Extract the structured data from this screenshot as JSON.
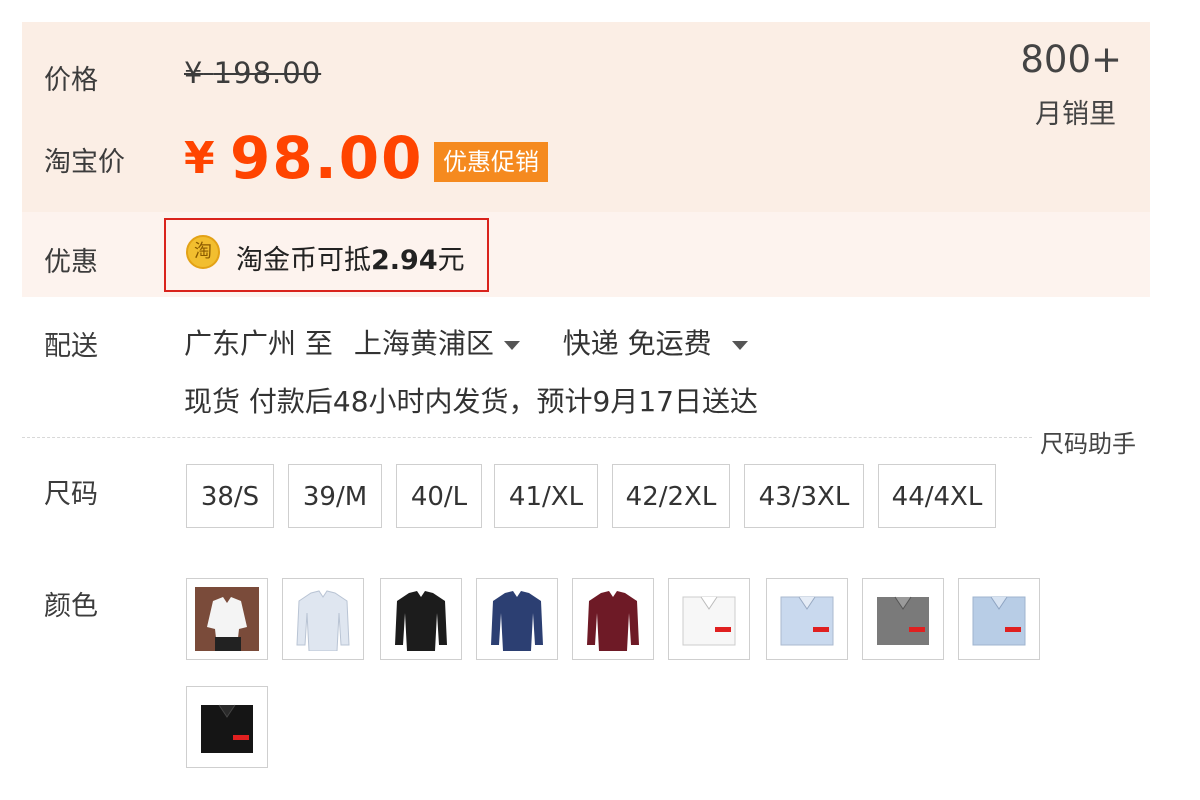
{
  "price": {
    "label": "价格",
    "original_currency": "¥",
    "original_value": "198.00",
    "taobao_label": "淘宝价",
    "currency": "¥",
    "value": "98.00",
    "promo_tag": "优惠促销",
    "sales_count": "800+",
    "sales_label": "月销里"
  },
  "discount": {
    "label": "优惠",
    "icon_text": "淘",
    "text": "淘金币可抵",
    "amount": "2.94",
    "unit": "元"
  },
  "shipping": {
    "label": "配送",
    "from": "广东广州 至",
    "to": "上海黄浦区",
    "method": "快递 免运费",
    "detail": "现货 付款后48小时内发货，预计9月17日送达"
  },
  "size": {
    "label": "尺码",
    "helper": "尺码助手",
    "options": [
      "38/S",
      "39/M",
      "40/L",
      "41/XL",
      "42/2XL",
      "43/3XL",
      "44/4XL"
    ]
  },
  "color": {
    "label": "颜色",
    "swatches": [
      {
        "name": "white-model",
        "color": "#f4f4f4"
      },
      {
        "name": "light-blue",
        "color": "#dfe6f0"
      },
      {
        "name": "black",
        "color": "#1c1c1c"
      },
      {
        "name": "navy",
        "color": "#2c3f72"
      },
      {
        "name": "burgundy",
        "color": "#6e1a26"
      },
      {
        "name": "white-folded",
        "color": "#f7f7f7"
      },
      {
        "name": "light-blue-folded",
        "color": "#c9d9ee"
      },
      {
        "name": "gray-folded",
        "color": "#7a7a7a"
      },
      {
        "name": "sky-blue-folded",
        "color": "#b8cde6"
      },
      {
        "name": "black-folded",
        "color": "#151515"
      }
    ]
  },
  "colors": {
    "accent": "#ff4400",
    "promo_tag_bg": "#f58a1f",
    "highlight_border": "#d9231c",
    "price_panel_bg": "#fbeee5"
  }
}
